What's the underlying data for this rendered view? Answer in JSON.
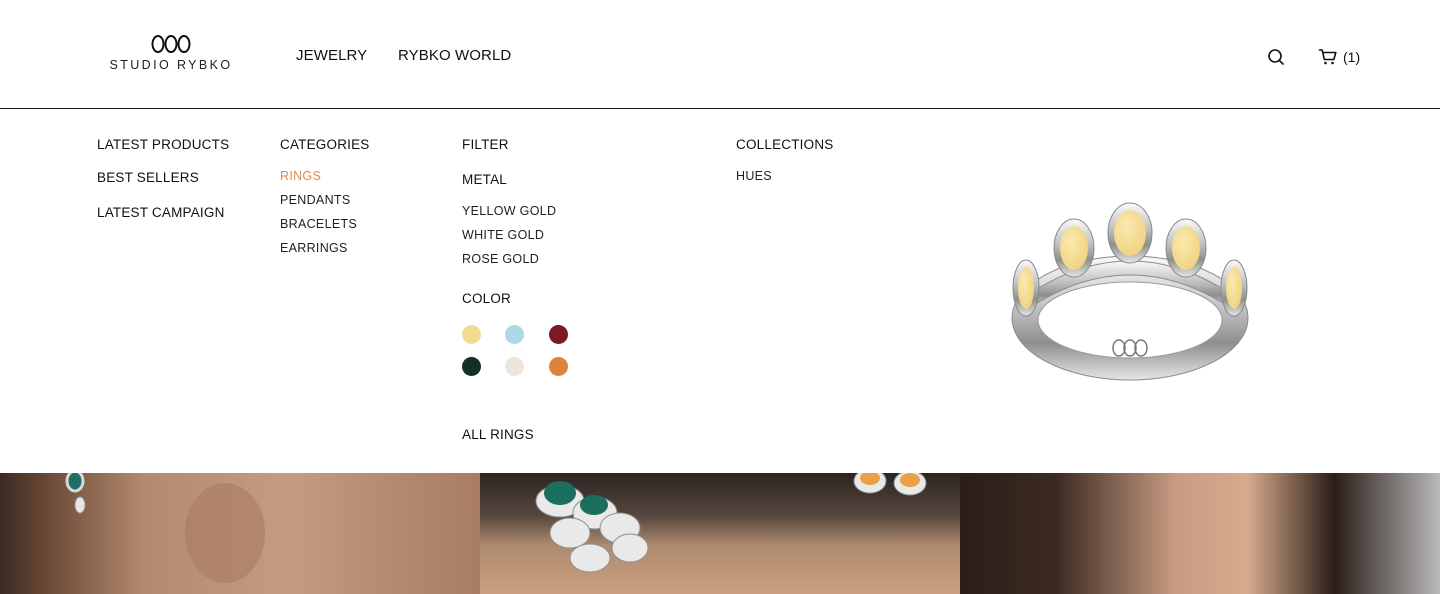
{
  "brand": {
    "name": "STUDIO RYBKO"
  },
  "nav": {
    "items": [
      "JEWELRY",
      "RYBKO WORLD"
    ]
  },
  "cart": {
    "count_label": "(1)"
  },
  "menu": {
    "featured": [
      "LATEST PRODUCTS",
      "BEST SELLERS",
      "LATEST CAMPAIGN"
    ],
    "categories": {
      "heading": "CATEGORIES",
      "items": [
        "RINGS",
        "PENDANTS",
        "BRACELETS",
        "EARRINGS"
      ],
      "active": "RINGS"
    },
    "filter": {
      "heading": "FILTER",
      "metal_heading": "METAL",
      "metals": [
        "YELLOW GOLD",
        "WHITE GOLD",
        "ROSE GOLD"
      ],
      "color_heading": "COLOR",
      "colors": [
        "#f3dc91",
        "#add8e6",
        "#7a1a28",
        "#123023",
        "#ede5dc",
        "#e1823a"
      ],
      "all_link": "ALL RINGS"
    },
    "collections": {
      "heading": "COLLECTIONS",
      "items": [
        "HUES"
      ]
    }
  },
  "colors": {
    "accent": "#e0894a",
    "border": "#1a1a1a"
  }
}
